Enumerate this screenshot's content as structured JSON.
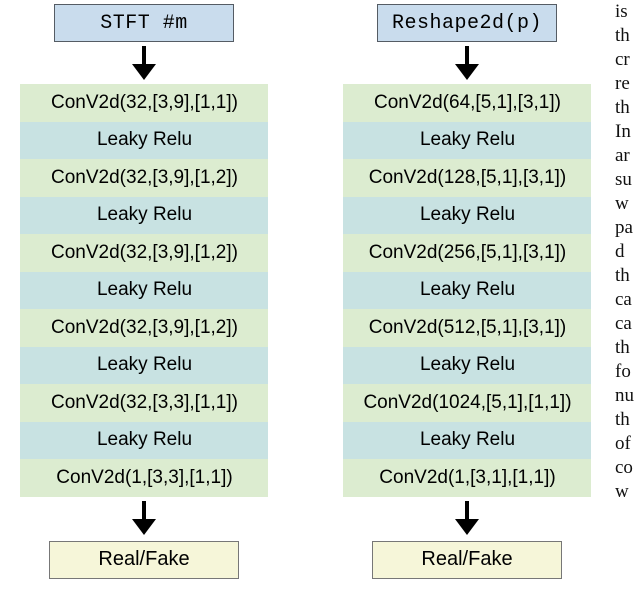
{
  "left": {
    "header": "STFT #m",
    "layers": [
      "ConV2d(32,[3,9],[1,1])",
      "Leaky Relu",
      "ConV2d(32,[3,9],[1,2])",
      "Leaky Relu",
      "ConV2d(32,[3,9],[1,2])",
      "Leaky Relu",
      "ConV2d(32,[3,9],[1,2])",
      "Leaky Relu",
      "ConV2d(32,[3,3],[1,1])",
      "Leaky Relu",
      "ConV2d(1,[3,3],[1,1])"
    ],
    "result": "Real/Fake"
  },
  "right": {
    "header": "Reshape2d(p)",
    "layers": [
      "ConV2d(64,[5,1],[3,1])",
      "Leaky Relu",
      "ConV2d(128,[5,1],[3,1])",
      "Leaky Relu",
      "ConV2d(256,[5,1],[3,1])",
      "Leaky Relu",
      "ConV2d(512,[5,1],[3,1])",
      "Leaky Relu",
      "ConV2d(1024,[5,1],[1,1])",
      "Leaky Relu",
      "ConV2d(1,[3,1],[1,1])"
    ],
    "result": "Real/Fake"
  },
  "edge_fragments": [
    "is",
    "th",
    "cr",
    "re",
    "th",
    "In",
    "ar",
    "su",
    "w",
    "",
    "pa",
    "d",
    "th",
    "ca",
    "ca",
    "th",
    "",
    "fo",
    "nu",
    "th",
    "of",
    "co",
    "w"
  ]
}
